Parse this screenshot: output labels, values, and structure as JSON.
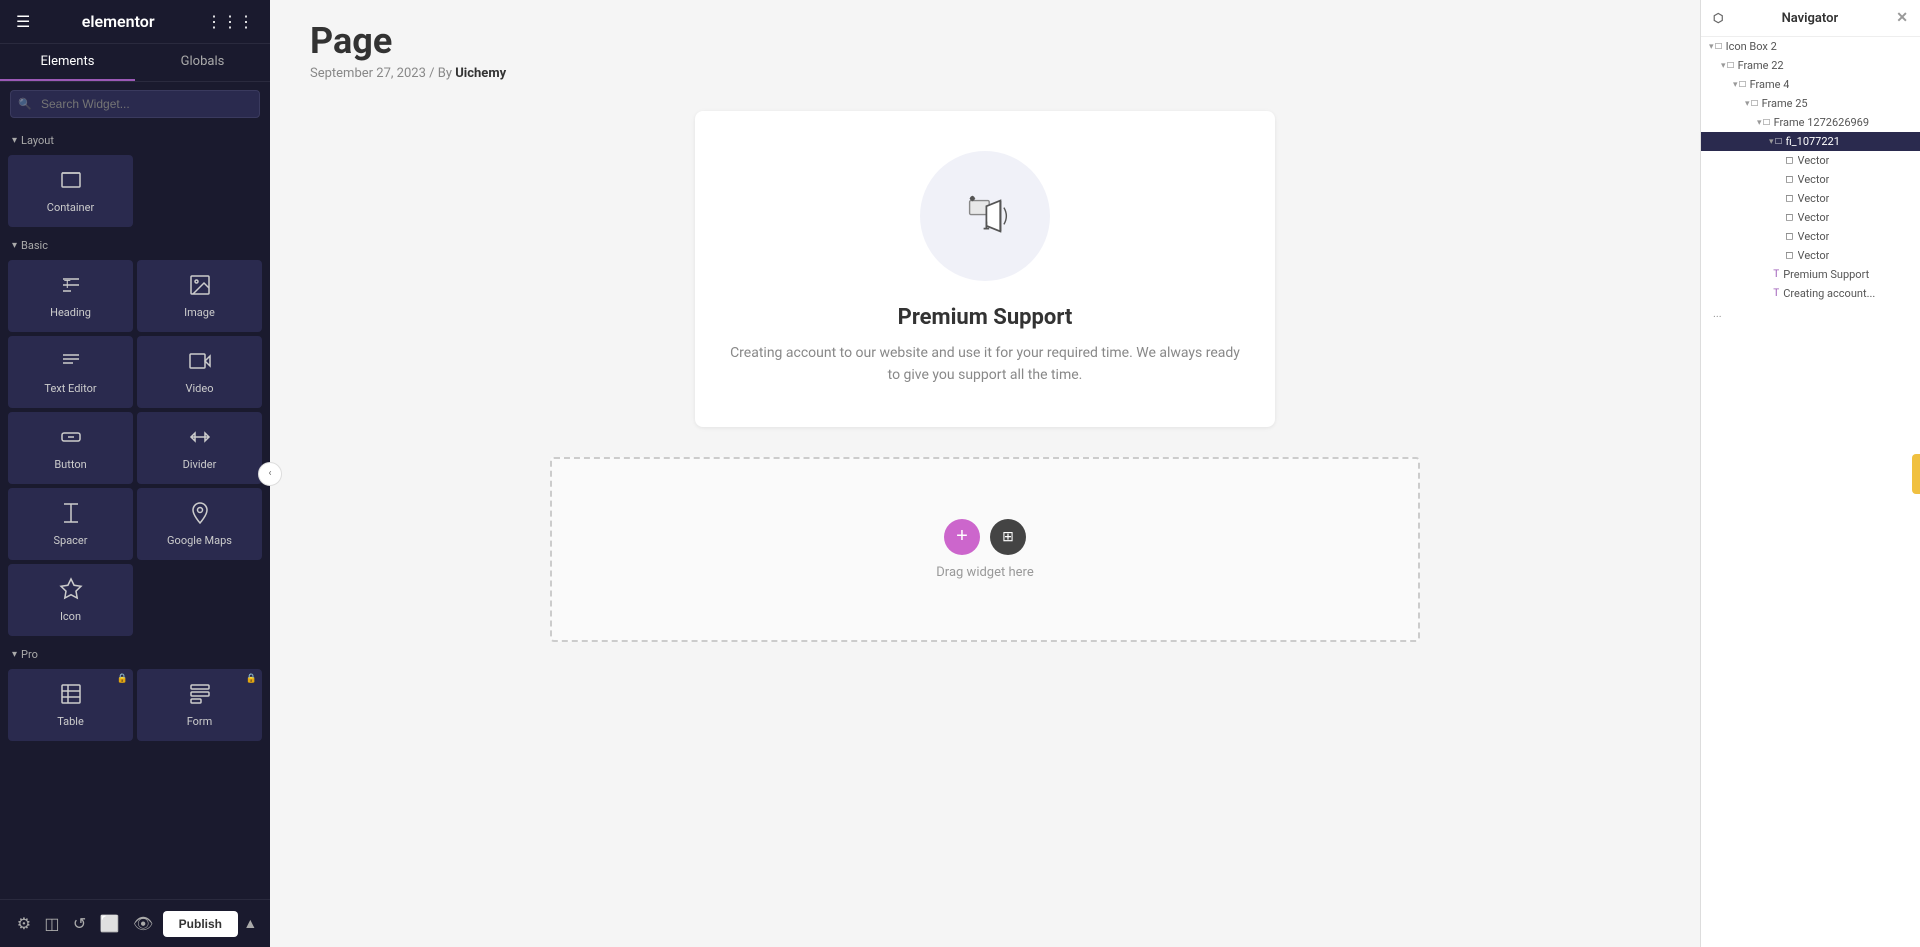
{
  "app": {
    "title": "elementor"
  },
  "sidebar": {
    "tabs": [
      {
        "label": "Elements",
        "active": true
      },
      {
        "label": "Globals",
        "active": false
      }
    ],
    "search_placeholder": "Search Widget...",
    "sections": [
      {
        "label": "Layout",
        "widgets": [
          {
            "id": "container",
            "label": "Container",
            "icon": "container"
          }
        ]
      },
      {
        "label": "Basic",
        "widgets": [
          {
            "id": "heading",
            "label": "Heading",
            "icon": "heading"
          },
          {
            "id": "image",
            "label": "Image",
            "icon": "image"
          },
          {
            "id": "text-editor",
            "label": "Text Editor",
            "icon": "text-editor"
          },
          {
            "id": "video",
            "label": "Video",
            "icon": "video"
          },
          {
            "id": "button",
            "label": "Button",
            "icon": "button"
          },
          {
            "id": "divider",
            "label": "Divider",
            "icon": "divider"
          },
          {
            "id": "spacer",
            "label": "Spacer",
            "icon": "spacer"
          },
          {
            "id": "google-maps",
            "label": "Google Maps",
            "icon": "google-maps"
          },
          {
            "id": "icon",
            "label": "Icon",
            "icon": "icon"
          }
        ]
      },
      {
        "label": "Pro",
        "widgets": [
          {
            "id": "table",
            "label": "Table",
            "icon": "table"
          },
          {
            "id": "form",
            "label": "Form",
            "icon": "form"
          }
        ]
      }
    ],
    "footer": {
      "publish_label": "Publish"
    }
  },
  "canvas": {
    "page_title": "Page",
    "page_date": "September 27, 2023",
    "page_by": "By",
    "page_author": "Uichemy",
    "card": {
      "title": "Premium Support",
      "description": "Creating account to our website and use it for your required time. We always ready to give you support all the time."
    },
    "drop_zone_label": "Drag widget here"
  },
  "navigator": {
    "title": "Navigator",
    "items": [
      {
        "id": "icon-box-2",
        "label": "Icon Box 2",
        "indent": 0,
        "type": "frame",
        "arrow": "▾",
        "selected": false
      },
      {
        "id": "frame-22",
        "label": "Frame 22",
        "indent": 1,
        "type": "frame",
        "arrow": "▾",
        "selected": false
      },
      {
        "id": "frame-4",
        "label": "Frame 4",
        "indent": 2,
        "type": "frame",
        "arrow": "▾",
        "selected": false
      },
      {
        "id": "frame-25",
        "label": "Frame 25",
        "indent": 3,
        "type": "frame",
        "arrow": "▾",
        "selected": false
      },
      {
        "id": "frame-1272626969",
        "label": "Frame 1272626969",
        "indent": 4,
        "type": "frame",
        "arrow": "▾",
        "selected": false
      },
      {
        "id": "fi-1077221",
        "label": "fi_1077221",
        "indent": 5,
        "type": "frame",
        "arrow": "▾",
        "selected": true
      },
      {
        "id": "vector-1",
        "label": "Vector",
        "indent": 6,
        "type": "vector",
        "arrow": "",
        "selected": false
      },
      {
        "id": "vector-2",
        "label": "Vector",
        "indent": 6,
        "type": "vector",
        "arrow": "",
        "selected": false
      },
      {
        "id": "vector-3",
        "label": "Vector",
        "indent": 6,
        "type": "vector",
        "arrow": "",
        "selected": false
      },
      {
        "id": "vector-4",
        "label": "Vector",
        "indent": 6,
        "type": "vector",
        "arrow": "",
        "selected": false
      },
      {
        "id": "vector-5",
        "label": "Vector",
        "indent": 6,
        "type": "vector",
        "arrow": "",
        "selected": false
      },
      {
        "id": "vector-6",
        "label": "Vector",
        "indent": 6,
        "type": "vector",
        "arrow": "",
        "selected": false
      },
      {
        "id": "premium-support",
        "label": "Premium Support",
        "indent": 5,
        "type": "text",
        "arrow": "",
        "selected": false
      },
      {
        "id": "creating-account",
        "label": "Creating account...",
        "indent": 5,
        "type": "text",
        "arrow": "",
        "selected": false
      }
    ],
    "ellipsis": "..."
  },
  "colors": {
    "sidebar_bg": "#1a1a2e",
    "accent": "#9b59b6",
    "navigator_selected": "#2a2a4e",
    "add_btn": "#cc66cc"
  }
}
